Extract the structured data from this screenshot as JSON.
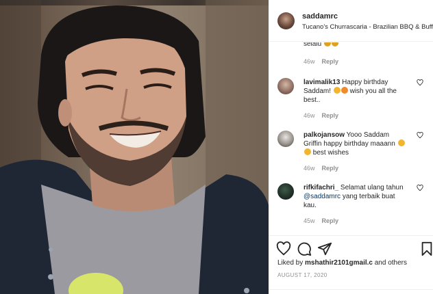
{
  "header": {
    "username": "saddamrc",
    "location": "Tucano's Churrascaria - Brazilian BBQ & Buffet"
  },
  "comments": [
    {
      "user": "",
      "text": "selalu",
      "age": "",
      "reply_label": ""
    },
    {
      "user": "lavimalik13",
      "text": "Happy birthday Saddam!",
      "text2": "wish you all the best..",
      "age": "46w",
      "reply_label": "Reply"
    },
    {
      "user": "palkojansow",
      "text": "Yooo Saddam Griffin happy birthday maaann",
      "text2": "best wishes",
      "age": "46w",
      "reply_label": "Reply"
    },
    {
      "user": "rifkifachri_",
      "text": "Selamat ulang tahun",
      "mention": "@saddamrc",
      "text2": "yang terbaik buat kau.",
      "age": "45w",
      "reply_label": "Reply"
    }
  ],
  "first_meta": {
    "age": "46w",
    "reply_label": "Reply"
  },
  "likes": {
    "prefix": "Liked by",
    "user": "mshathir2101gmail.c",
    "suffix": "and others"
  },
  "date": "AUGUST 17, 2020",
  "icons": {
    "like": "heart-icon",
    "comment": "comment-icon",
    "share": "share-icon",
    "save": "bookmark-icon"
  },
  "colors": {
    "text": "#262626",
    "muted": "#8e8e8e",
    "border": "#efefef",
    "mention": "#00376b"
  }
}
